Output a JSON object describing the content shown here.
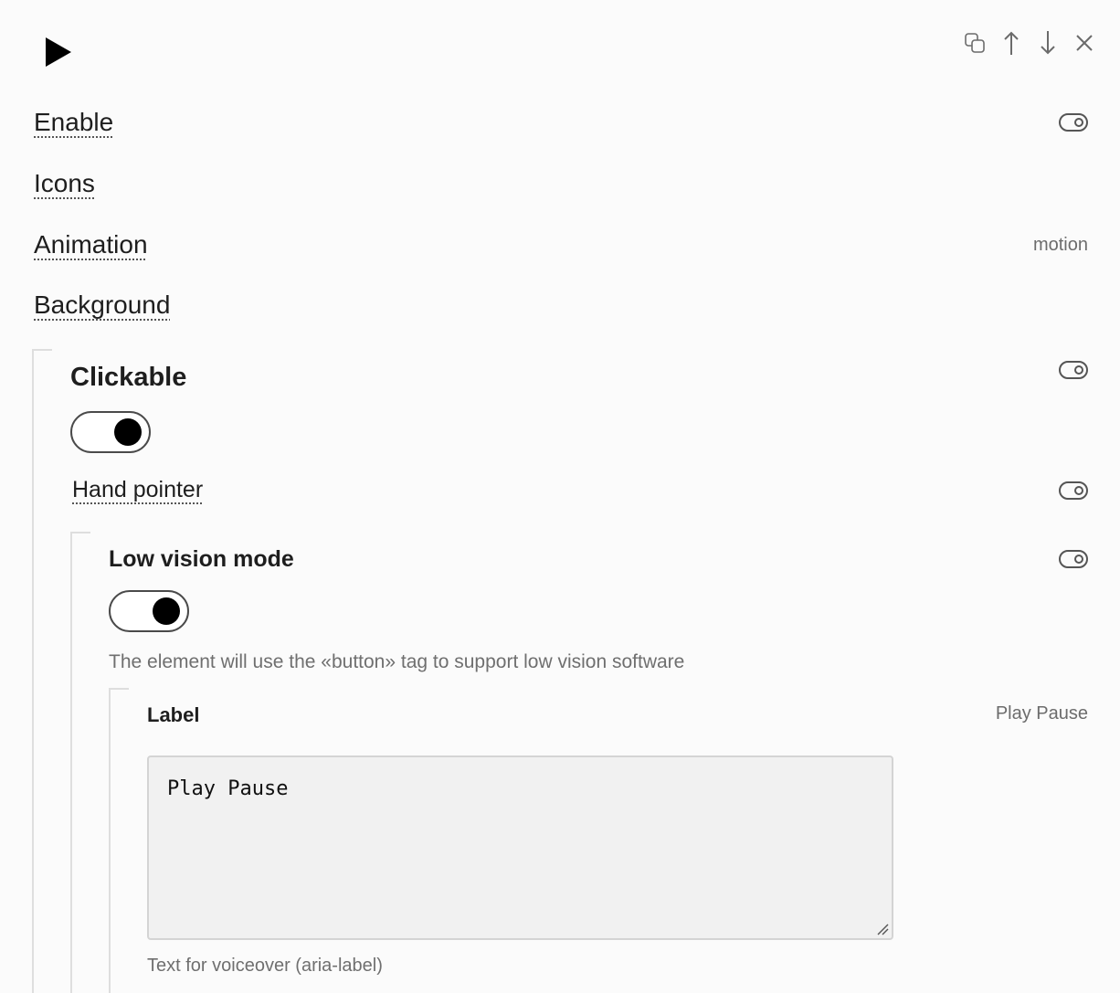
{
  "header": {
    "icon": "play-icon",
    "toolbar": [
      "copy-icon",
      "arrow-up-icon",
      "arrow-down-icon",
      "close-icon"
    ]
  },
  "rows": {
    "enable": {
      "label": "Enable"
    },
    "icons": {
      "label": "Icons"
    },
    "animation": {
      "label": "Animation",
      "value": "motion"
    },
    "background": {
      "label": "Background"
    }
  },
  "clickable": {
    "title": "Clickable",
    "enabled": true,
    "hand_pointer": {
      "label": "Hand pointer"
    }
  },
  "low_vision": {
    "title": "Low vision mode",
    "enabled": true,
    "help": "The element will use the «button» tag to support low vision software"
  },
  "label_field": {
    "title": "Label",
    "value_display": "Play Pause",
    "textarea_value": "Play Pause",
    "help": "Text for voiceover (aria-label)"
  }
}
